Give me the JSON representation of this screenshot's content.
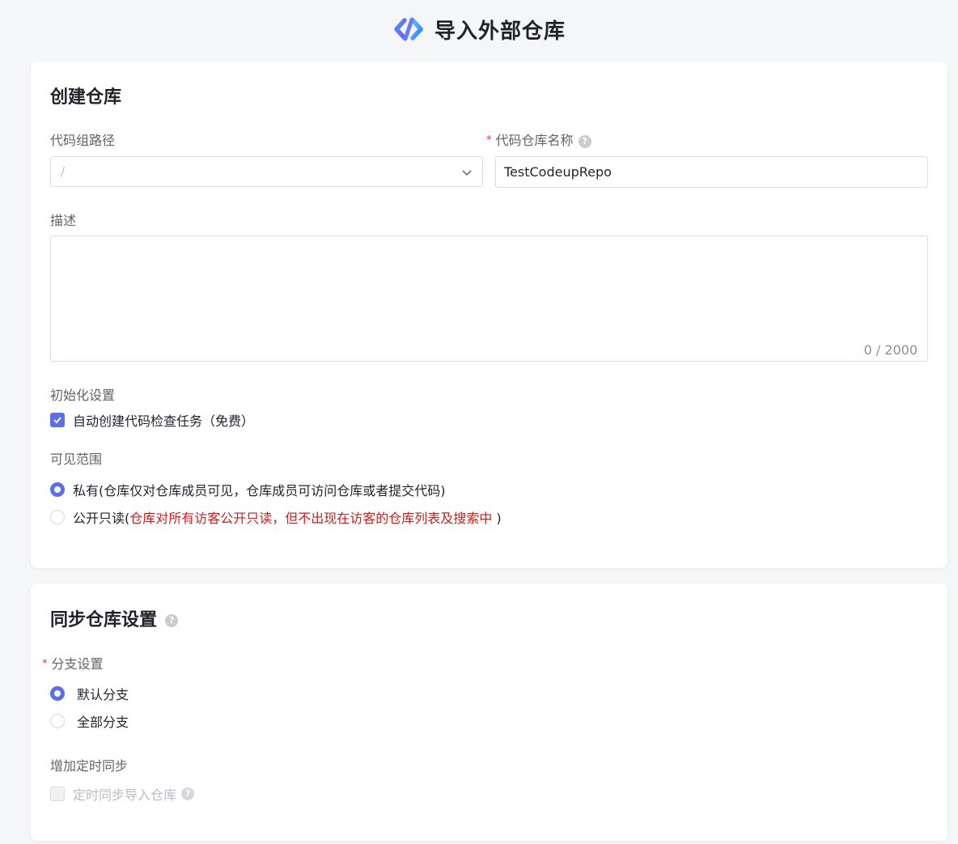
{
  "header": {
    "title": "导入外部仓库",
    "logo_icon": "codeup-logo-icon"
  },
  "create_section": {
    "title": "创建仓库",
    "group_path": {
      "label": "代码组路径",
      "value": "/"
    },
    "repo_name": {
      "label": "代码仓库名称",
      "value": "TestCodeupRepo",
      "required_mark": "*"
    },
    "description": {
      "label": "描述",
      "value": "",
      "counter": "0 / 2000"
    },
    "init": {
      "label": "初始化设置",
      "auto_check_label": "自动创建代码检查任务（免费）",
      "auto_check_checked": true
    },
    "visibility": {
      "label": "可见范围",
      "private_label": "私有(仓库仅对仓库成员可见，仓库成员可访问仓库或者提交代码)",
      "public_prefix": "公开只读(",
      "public_note": "仓库对所有访客公开只读，但不出现在访客的仓库列表及搜索中",
      "public_suffix": " )",
      "selected": "private"
    }
  },
  "sync_section": {
    "title": "同步仓库设置",
    "branch": {
      "label": "分支设置",
      "required_mark": "*",
      "default_label": "默认分支",
      "all_label": "全部分支",
      "selected": "default"
    },
    "schedule": {
      "label": "增加定时同步",
      "checkbox_label": "定时同步导入仓库",
      "disabled": true
    }
  },
  "colors": {
    "accent": "#5b6fe6",
    "required": "#e53935",
    "warning_text": "#c81e1e"
  }
}
